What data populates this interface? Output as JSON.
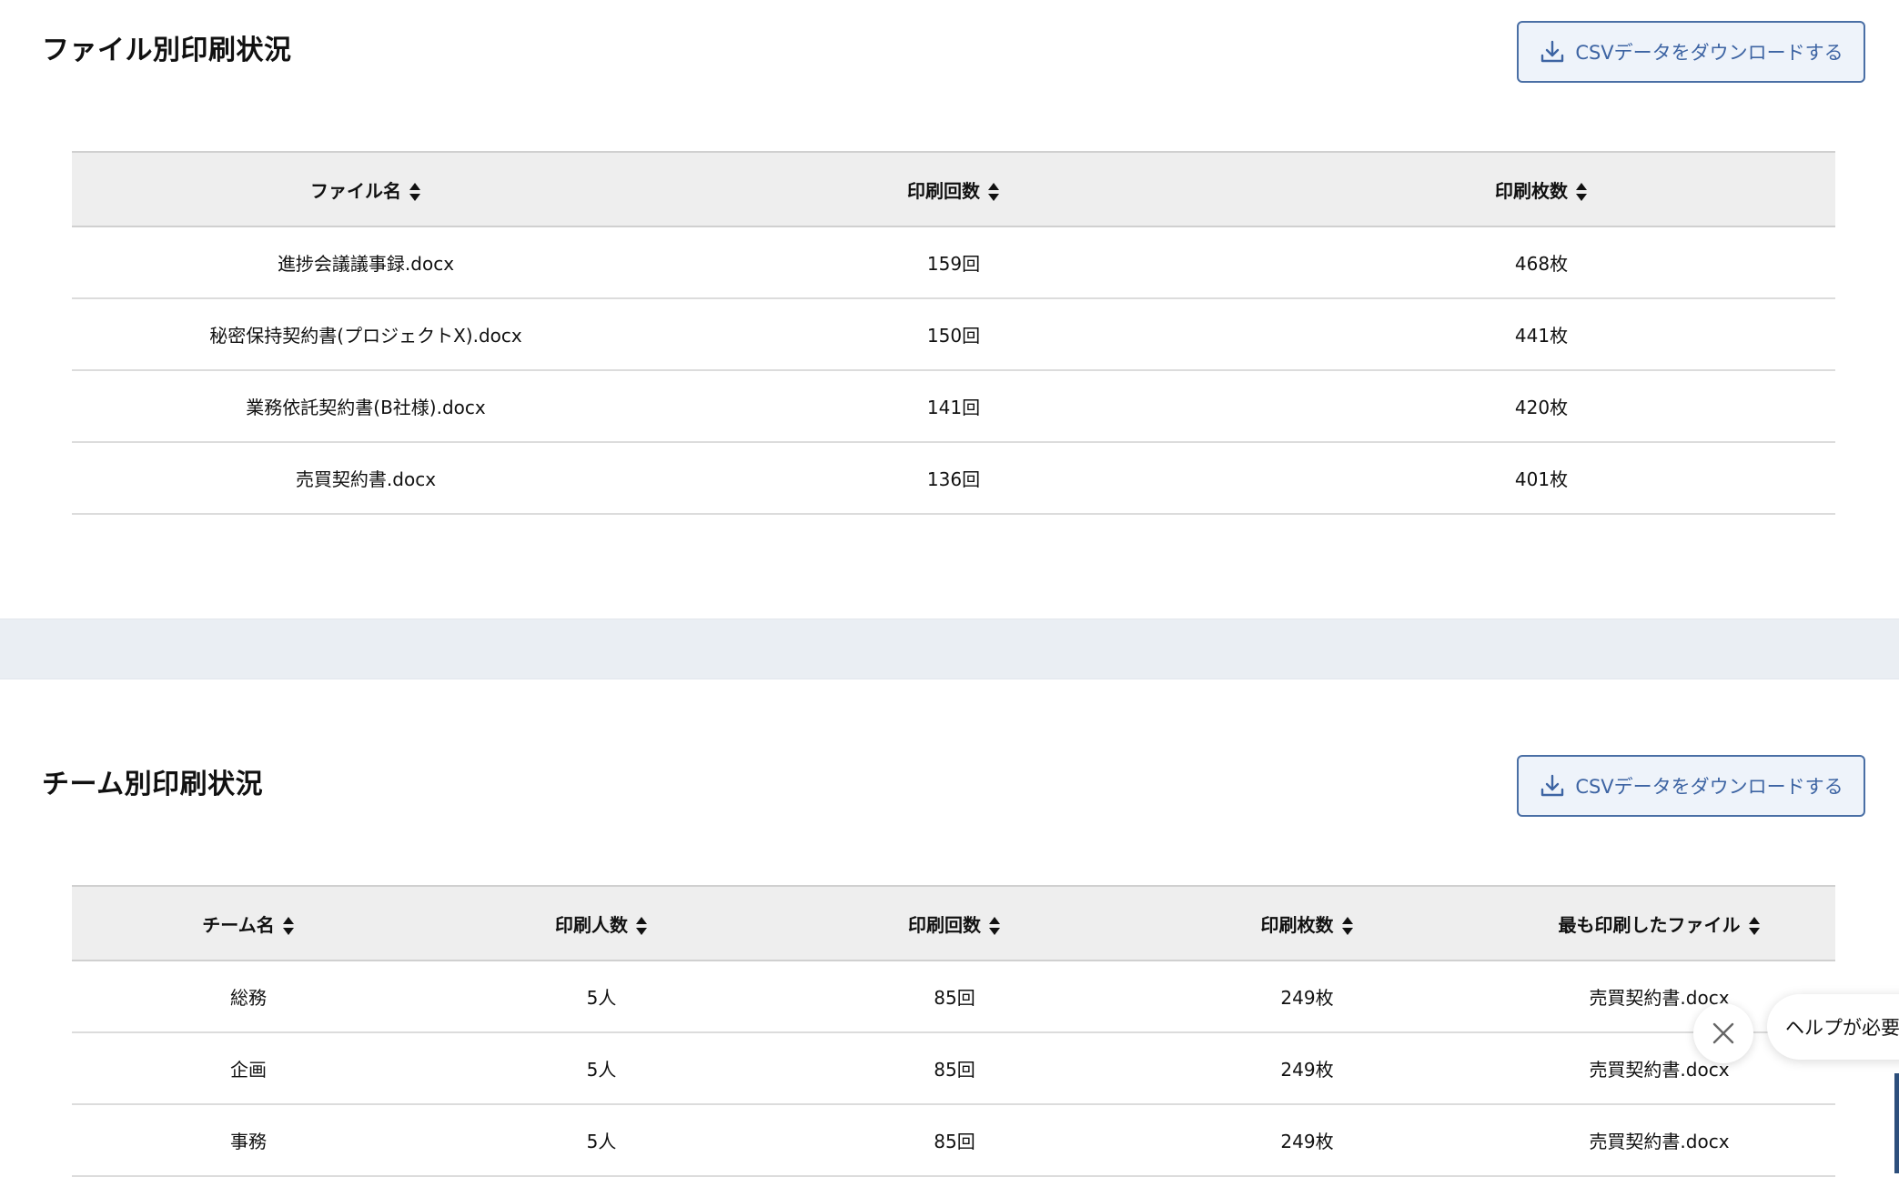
{
  "file_section": {
    "title": "ファイル別印刷状況",
    "csv_button": "CSVデータをダウンロードする",
    "columns": [
      "ファイル名",
      "印刷回数",
      "印刷枚数"
    ],
    "rows": [
      [
        "進捗会議議事録.docx",
        "159回",
        "468枚"
      ],
      [
        "秘密保持契約書(プロジェクトX).docx",
        "150回",
        "441枚"
      ],
      [
        "業務依託契約書(B社様).docx",
        "141回",
        "420枚"
      ],
      [
        "売買契約書.docx",
        "136回",
        "401枚"
      ]
    ]
  },
  "team_section": {
    "title": "チーム別印刷状況",
    "csv_button": "CSVデータをダウンロードする",
    "columns": [
      "チーム名",
      "印刷人数",
      "印刷回数",
      "印刷枚数",
      "最も印刷したファイル"
    ],
    "rows": [
      [
        "総務",
        "5人",
        "85回",
        "249枚",
        "売買契約書.docx"
      ],
      [
        "企画",
        "5人",
        "85回",
        "249枚",
        "売買契約書.docx"
      ],
      [
        "事務",
        "5人",
        "85回",
        "249枚",
        "売買契約書.docx"
      ]
    ]
  },
  "help": {
    "text": "ヘルプが必要"
  },
  "icons": {
    "download": "download-icon",
    "sort": "sort-icon",
    "close": "close-icon"
  },
  "colors": {
    "accent": "#3d64a3",
    "header_bg": "#eeeeee",
    "band_bg": "#eaeef3"
  }
}
